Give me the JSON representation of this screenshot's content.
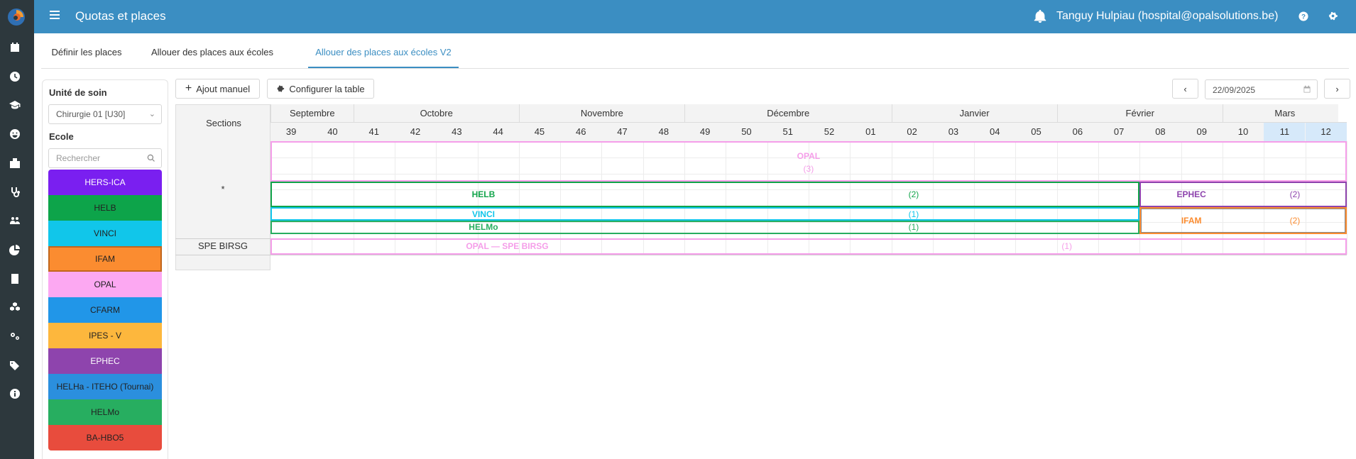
{
  "app": {
    "title": "Quotas et places",
    "user": "Tanguy Hulpiau (hospital@opalsolutions.be)"
  },
  "colors": {
    "topbar": "#3b8ec2",
    "rail": "#2d383d",
    "accent": "#3b8ec2"
  },
  "rail_icons": [
    "calendar-icon",
    "clock-icon",
    "graduation-cap-icon",
    "smiley-icon",
    "hospital-icon",
    "stethoscope-icon",
    "users-icon",
    "pie-chart-icon",
    "id-card-icon",
    "cubes-icon",
    "cogs-icon",
    "tags-icon",
    "info-icon"
  ],
  "tabs": [
    {
      "label": "Définir les places",
      "active": false
    },
    {
      "label": "Allouer des places aux écoles",
      "active": false
    },
    {
      "label": "Allouer des places aux écoles V2",
      "active": true
    }
  ],
  "panel": {
    "unit_label": "Unité de soin",
    "unit_value": "Chirurgie 01 [U30]",
    "school_label": "Ecole",
    "search_placeholder": "Rechercher",
    "schools": [
      {
        "name": "HERS-ICA",
        "bg": "#7a1ff0",
        "fg": "#ffffff"
      },
      {
        "name": "HELB",
        "bg": "#0da44a",
        "fg": "#222222"
      },
      {
        "name": "VINCI",
        "bg": "#11c6ea",
        "fg": "#222222"
      },
      {
        "name": "IFAM",
        "bg": "#fb8c30",
        "fg": "#222222",
        "selected": true
      },
      {
        "name": "OPAL",
        "bg": "#fca8f2",
        "fg": "#222222"
      },
      {
        "name": "CFARM",
        "bg": "#2196e8",
        "fg": "#222222"
      },
      {
        "name": "IPES - V",
        "bg": "#fdb73d",
        "fg": "#222222"
      },
      {
        "name": "EPHEC",
        "bg": "#8e44ad",
        "fg": "#ffffff"
      },
      {
        "name": "HELHa - ITEHO (Tournai)",
        "bg": "#2b8fde",
        "fg": "#222222"
      },
      {
        "name": "HELMo",
        "bg": "#27ae60",
        "fg": "#222222"
      },
      {
        "name": "BA-HBO5",
        "bg": "#e84c3d",
        "fg": "#222222"
      }
    ]
  },
  "toolbar": {
    "add_label": "Ajout manuel",
    "config_label": "Configurer la table",
    "date": "22/09/2025"
  },
  "grid": {
    "sections_header": "Sections",
    "months": [
      {
        "name": "Septembre",
        "weeks": 2
      },
      {
        "name": "Octobre",
        "weeks": 4
      },
      {
        "name": "Novembre",
        "weeks": 4
      },
      {
        "name": "Décembre",
        "weeks": 5
      },
      {
        "name": "Janvier",
        "weeks": 4
      },
      {
        "name": "Février",
        "weeks": 4
      },
      {
        "name": "Mars",
        "weeks": 3
      }
    ],
    "weeks": [
      "39",
      "40",
      "41",
      "42",
      "43",
      "44",
      "45",
      "46",
      "47",
      "48",
      "49",
      "50",
      "51",
      "52",
      "01",
      "02",
      "03",
      "04",
      "05",
      "06",
      "07",
      "08",
      "09",
      "10",
      "11",
      "12"
    ],
    "highlighted_weeks": [
      "11",
      "12"
    ],
    "sections": [
      "*",
      "SPE BIRSG"
    ],
    "allocations": [
      {
        "school": "OPAL",
        "count": "(3)",
        "color": "#f59ee9",
        "section": "*",
        "start_week": "39",
        "end_week": "12"
      },
      {
        "school": "HELB",
        "count": "(2)",
        "color": "#11a44a",
        "section": "*",
        "start_week": "39",
        "end_week": "07"
      },
      {
        "school": "EPHEC",
        "count": "(2)",
        "color": "#8e44ad",
        "section": "*",
        "start_week": "08",
        "end_week": "12"
      },
      {
        "school": "VINCI",
        "count": "(1)",
        "color": "#11c6ea",
        "section": "*",
        "start_week": "39",
        "end_week": "07"
      },
      {
        "school": "HELMo",
        "count": "(1)",
        "color": "#27ae60",
        "section": "*",
        "start_week": "39",
        "end_week": "07"
      },
      {
        "school": "IFAM",
        "count": "(2)",
        "color": "#fb8c30",
        "section": "*",
        "start_week": "08",
        "end_week": "12"
      },
      {
        "school": "OPAL — SPE BIRSG",
        "count": "(1)",
        "color": "#f59ee9",
        "section": "SPE BIRSG",
        "start_week": "39",
        "end_week": "12"
      }
    ]
  }
}
